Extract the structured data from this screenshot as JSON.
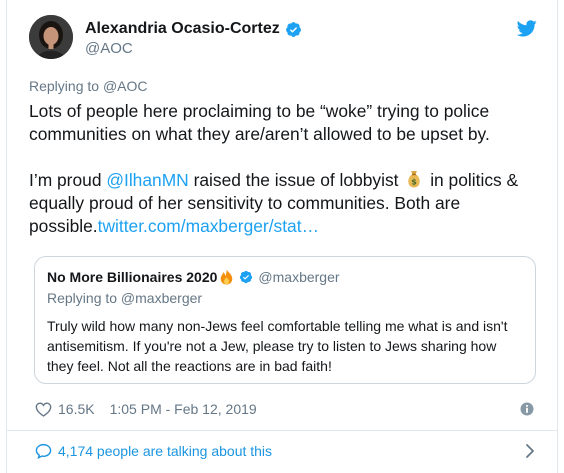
{
  "tweet": {
    "author_name": "Alexandria Ocasio-Cortez",
    "author_handle": "@AOC",
    "replying_prefix": "Replying to ",
    "replying_handle": "@AOC",
    "paragraph1": "Lots of people here proclaiming to be “woke” trying to police communities on what they are/aren’t allowed to be upset by.",
    "p2_part1": "I’m proud ",
    "p2_mention": "@IlhanMN",
    "p2_part2": " raised the issue of lobbyist ",
    "p2_part3": " in politics & equally proud of her sensitivity to communities. Both are possible.",
    "p2_link": "twitter.com/maxberger/stat…"
  },
  "quoted": {
    "name": "No More Billionaires 2020",
    "handle": "@maxberger",
    "replying_text": "Replying to @maxberger",
    "text": "Truly wild how many non-Jews feel comfortable telling me what is and isn't antisemitism. If you're not a Jew, please try to listen to Jews sharing how they feel. Not all the reactions are in bad faith!"
  },
  "meta": {
    "likes": "16.5K",
    "timestamp": "1:05 PM - Feb 12, 2019"
  },
  "footer": {
    "talking_text": "4,174 people are talking about this"
  },
  "icons": {
    "verified": "verified-badge-icon",
    "twitter": "twitter-bird-icon",
    "like": "heart-icon",
    "info": "info-icon",
    "comments": "speech-bubble-icon",
    "expand": "chevron-right-icon",
    "money": "money-bag-emoji",
    "fire": "fire-emoji"
  },
  "colors": {
    "accent": "#1da1f2",
    "secondary_text": "#657786",
    "primary_text": "#14171a",
    "border": "#e1e8ed"
  }
}
